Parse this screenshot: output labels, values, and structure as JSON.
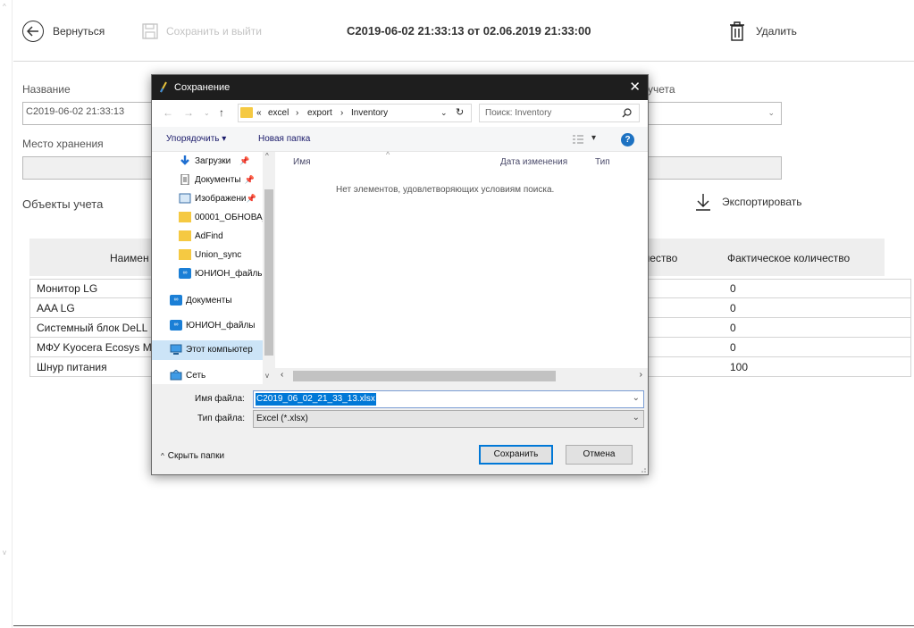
{
  "app": {
    "back_label": "Вернуться",
    "save_exit_label": "Сохранить и выйти",
    "doc_title": "C2019-06-02 21:33:13 от 02.06.2019 21:33:00",
    "delete_label": "Удалить",
    "name_label": "Название",
    "name_value": "C2019-06-02 21:33:13",
    "storage_label": "Место хранения",
    "accounting_label_partial": "учета",
    "objects_label": "Объекты учета",
    "export_label": "Экспортировать",
    "table": {
      "col_name_partial": "Наимен",
      "col_qty_partial": "чество",
      "col_actual": "Фактическое количество",
      "rows": [
        {
          "name": "Монитор LG",
          "actual": "0"
        },
        {
          "name": "AAA LG",
          "actual": "0"
        },
        {
          "name": "Системный блок DeLL",
          "actual": "0"
        },
        {
          "name": "МФУ Kyocera Ecosys M",
          "actual": "0"
        },
        {
          "name": "Шнур питания",
          "actual": "100"
        }
      ]
    }
  },
  "dialog": {
    "title": "Сохранение",
    "close": "✕",
    "path": [
      "«",
      "excel",
      "›",
      "export",
      "›",
      "Inventory"
    ],
    "search_placeholder": "Поиск: Inventory",
    "organize_label": "Упорядочить ▾",
    "new_folder_label": "Новая папка",
    "tree": [
      "Загрузки",
      "Документы",
      "Изображени",
      "00001_ОБНОВА_",
      "AdFind",
      "Union_sync",
      "ЮНИОН_файль",
      "Документы",
      "ЮНИОН_файлы",
      "Этот компьютер",
      "Сеть"
    ],
    "columns": {
      "name": "Имя",
      "modified": "Дата изменения",
      "type": "Тип"
    },
    "empty_message": "Нет элементов, удовлетворяющих условиям поиска.",
    "filename_label": "Имя файла:",
    "filename_value": "C2019_06_02_21_33_13.xlsx",
    "filetype_label": "Тип файла:",
    "filetype_value": "Excel (*.xlsx)",
    "hide_folders_label": "Скрыть папки",
    "save_button": "Сохранить",
    "cancel_button": "Отмена"
  }
}
